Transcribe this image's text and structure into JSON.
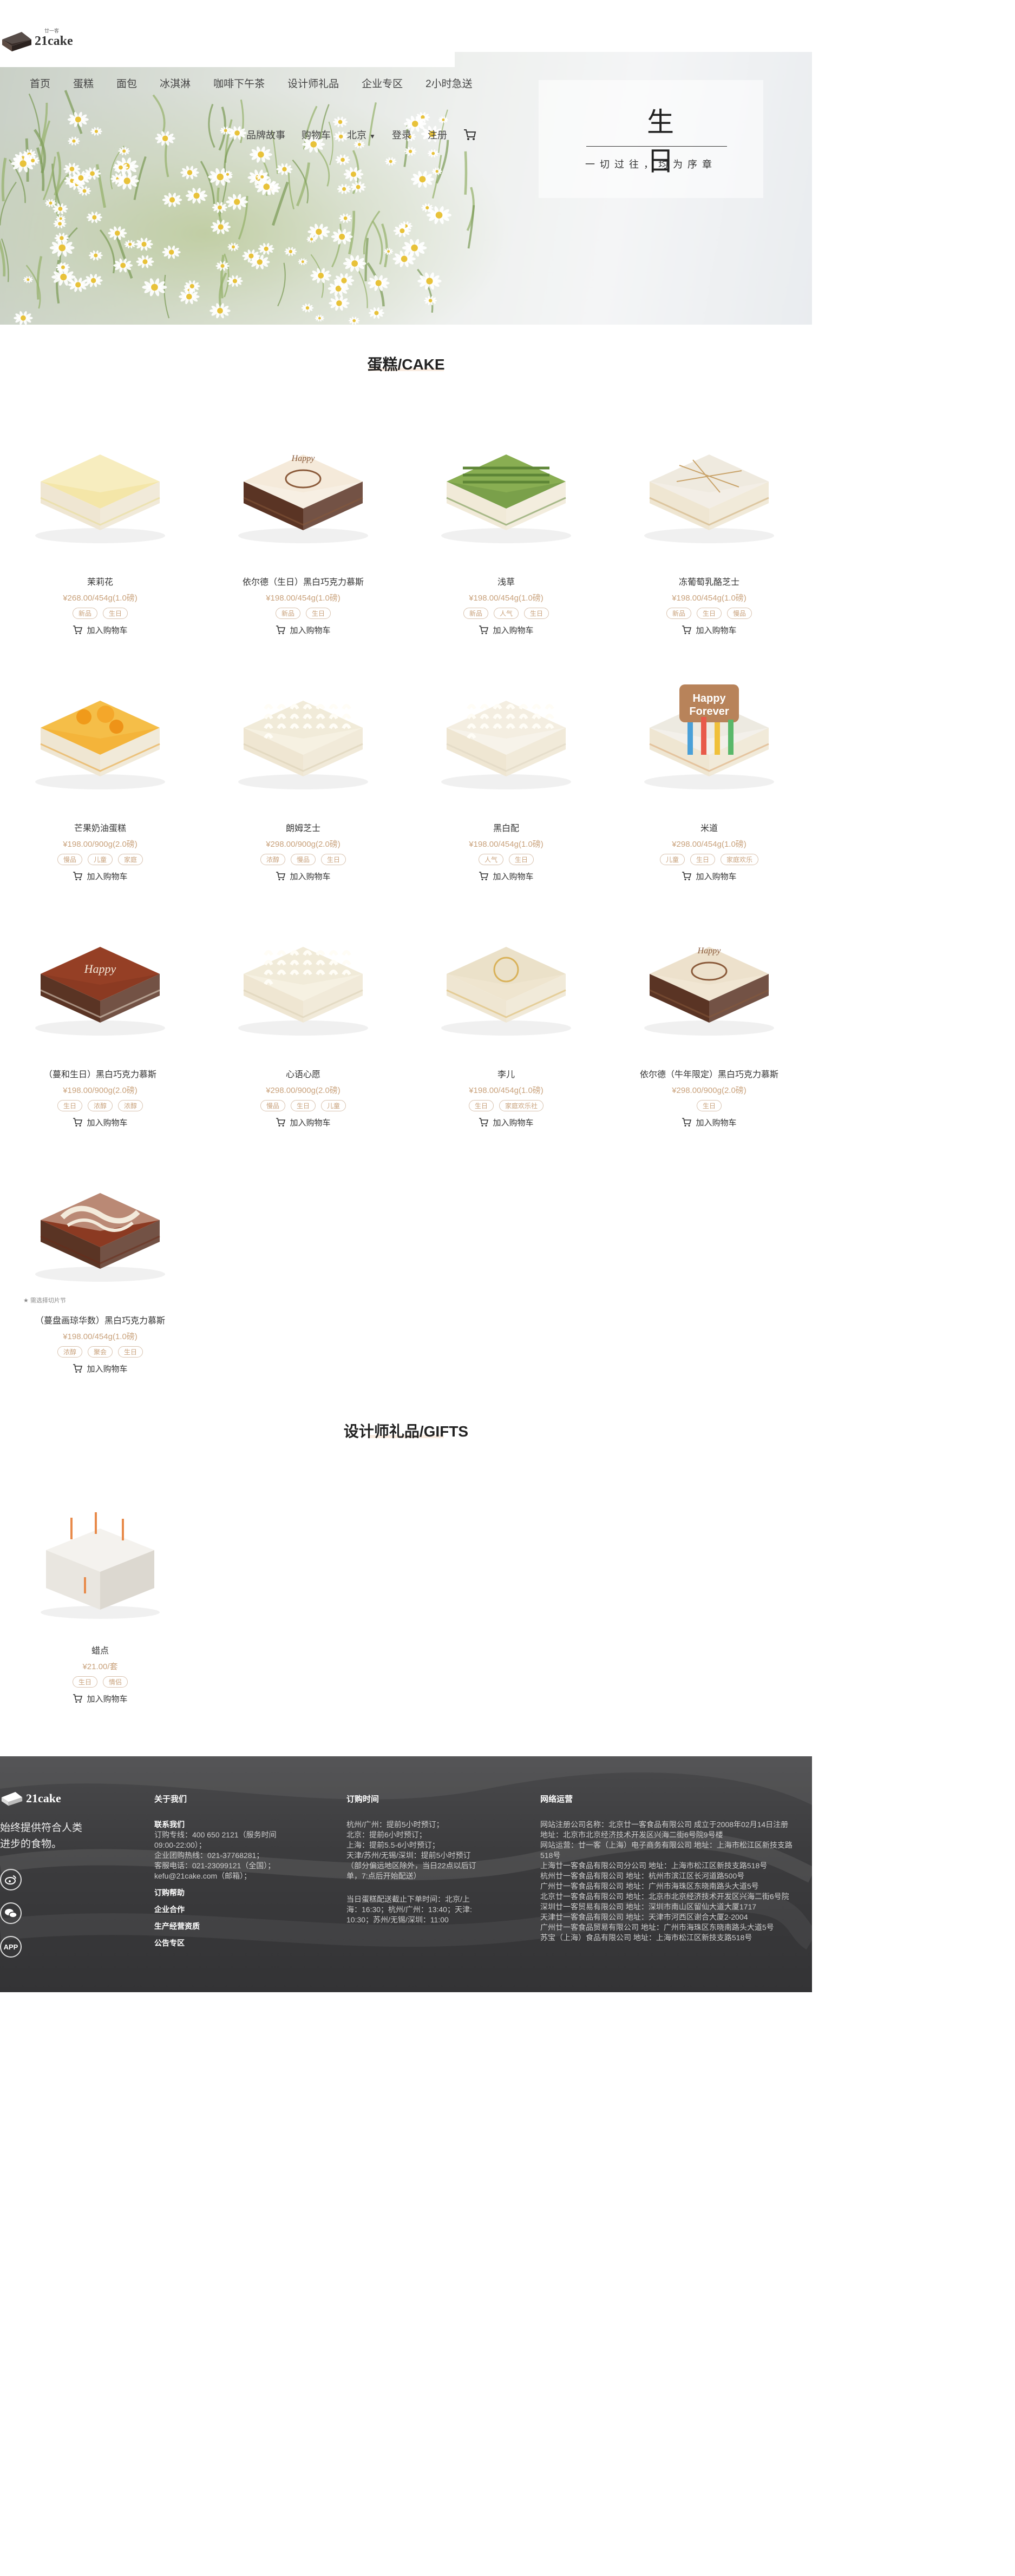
{
  "header": {
    "brand": "21cake",
    "brand_small": "廿一客",
    "nav": [
      "首页",
      "蛋糕",
      "面包",
      "冰淇淋",
      "咖啡下午茶",
      "设计师礼品",
      "企业专区",
      "2小时急送",
      "品牌故事",
      "购物车",
      "登录",
      "注册"
    ],
    "nav_visible": [
      "首页",
      "蛋糕",
      "面包",
      "冰淇淋",
      "咖啡下午茶",
      "设计师礼品",
      "企业专区",
      "2小时急送"
    ],
    "city": "北京",
    "login": "登录",
    "register": "注册"
  },
  "banner": {
    "title": "生日",
    "subtitle": "一切过往，均为序章"
  },
  "cake_section": {
    "title": "蛋糕/CAKE"
  },
  "cakes": [
    {
      "name": "茉莉花",
      "price": "¥268.00/454g(1.0磅)",
      "tags": [
        "新品",
        "生日"
      ],
      "add": "加入购物车",
      "style": "jasmine"
    },
    {
      "name": "依尔德（生日）黑白巧克力慕斯",
      "price": "¥198.00/454g(1.0磅)",
      "tags": [
        "新品",
        "生日"
      ],
      "add": "加入购物车",
      "style": "birthday"
    },
    {
      "name": "浅草",
      "price": "¥198.00/454g(1.0磅)",
      "tags": [
        "新品",
        "人气",
        "生日"
      ],
      "add": "加入购物车",
      "style": "matcha"
    },
    {
      "name": "冻葡萄乳酪芝士",
      "price": "¥198.00/454g(1.0磅)",
      "tags": [
        "新品",
        "生日",
        "慢品"
      ],
      "add": "加入购物车",
      "style": "cheese"
    },
    {
      "name": "芒果奶油蛋糕",
      "price": "¥198.00/900g(2.0磅)",
      "tags": [
        "慢品",
        "儿童",
        "家庭"
      ],
      "add": "加入购物车",
      "style": "mango"
    },
    {
      "name": "朗姆芝士",
      "price": "¥298.00/900g(2.0磅)",
      "tags": [
        "浓醇",
        "慢品",
        "生日"
      ],
      "add": "加入购物车",
      "style": "cream"
    },
    {
      "name": "黑白配",
      "price": "¥198.00/454g(1.0磅)",
      "tags": [
        "人气",
        "生日"
      ],
      "add": "加入购物车",
      "style": "flake"
    },
    {
      "name": "米道",
      "price": "¥298.00/454g(1.0磅)",
      "tags": [
        "儿童",
        "生日",
        "家庭欢乐"
      ],
      "add": "加入购物车",
      "style": "happy"
    },
    {
      "name": "（蔓和生日）黑白巧克力慕斯",
      "price": "¥198.00/900g(2.0磅)",
      "tags": [
        "生日",
        "浓醇",
        "浓醇"
      ],
      "add": "加入购物车",
      "style": "chocolate"
    },
    {
      "name": "心语心愿",
      "price": "¥298.00/900g(2.0磅)",
      "tags": [
        "慢品",
        "生日",
        "儿童"
      ],
      "add": "加入购物车",
      "style": "cream"
    },
    {
      "name": "李儿",
      "price": "¥198.00/454g(1.0磅)",
      "tags": [
        "生日",
        "家庭欢乐社"
      ],
      "add": "加入购物车",
      "style": "seal"
    },
    {
      "name": "依尔德（牛年限定）黑白巧克力慕斯",
      "price": "¥298.00/900g(2.0磅)",
      "tags": [
        "生日"
      ],
      "add": "加入购物车",
      "style": "ox"
    },
    {
      "name": "（蔓盘画琼华数）黑白巧克力慕斯",
      "price": "¥198.00/454g(1.0磅)",
      "tags": [
        "浓醇",
        "聚会",
        "生日"
      ],
      "add": "加入购物车",
      "style": "swirl",
      "tip": "★ 需选择切片节"
    }
  ],
  "gift_section": {
    "title": "设计师礼品/GIFTS"
  },
  "gifts": [
    {
      "name": "蜡点",
      "price": "¥21.00/套",
      "tags": [
        "生日",
        "情侣"
      ],
      "add": "加入购物车"
    }
  ],
  "footer": {
    "brand": "21cake",
    "slogan": [
      "始终提供符合人类",
      "进步的食物。"
    ],
    "icons": [
      "weibo-icon",
      "wechat-icon",
      "APP"
    ],
    "about": {
      "heading": "关于我们",
      "contact_title": "联系我们",
      "contact_lines": [
        "订购专线：400 650 2121（服务时间",
        "09:00-22:00）；",
        "企业团购热线：021-37768281；",
        "客服电话：021-23099121（全国）；",
        "kefu@21cake.com（邮箱）；"
      ],
      "links": [
        "订购帮助",
        "企业合作",
        "生产经营资质",
        "公告专区"
      ]
    },
    "order_time": {
      "heading": "订购时间",
      "lines": [
        "杭州/广州：提前5小时预订；",
        "北京：提前6小时预订；",
        "上海：提前5.5-6小时预订；",
        "天津/苏州/无锡/深圳：提前5小时预订",
        "（部分偏远地区除外，当日22点以后订",
        "单，7:点后开始配送）"
      ],
      "lines2": [
        "当日蛋糕配送截止下单时间：北京/上",
        "海：16:30；杭州/广州：13:40；天津:",
        "10:30；苏州/无锡/深圳：11:00"
      ]
    },
    "company": {
      "heading": "网络运营",
      "lines": [
        "网站注册公司名称：北京廿一客食品有限公司 成立于2008年02月14日注册",
        "地址：北京市北京经济技术开发区兴海二街6号院9号楼",
        "网站运营：廿一客（上海）电子商务有限公司 地址：上海市松江区新技支路",
        "518号",
        "上海廿一客食品有限公司分公司 地址：上海市松江区新技支路518号",
        "杭州廿一客食品有限公司 地址：杭州市滨江区长河道路500号",
        "广州廿一客食品有限公司 地址：广州市海珠区东晓南路头大道5号",
        "北京廿一客食品有限公司 地址：北京市北京经济技术开发区兴海二街6号院",
        "深圳廿一客贸易有限公司 地址：深圳市南山区留仙大道大厦1717",
        "天津廿一客食品有限公司 地址：天津市河西区谢合大厦2-2004",
        "广州廿一客食品贸易有限公司 地址：广州市海珠区东晓南路头大道5号",
        "苏宝（上海）食品有限公司 地址：上海市松江区新技支路518号"
      ]
    }
  },
  "colors": {
    "accent": "#c9a27c",
    "tag_border": "#d8c2ae",
    "footer_bg": "#3c3c3e"
  }
}
